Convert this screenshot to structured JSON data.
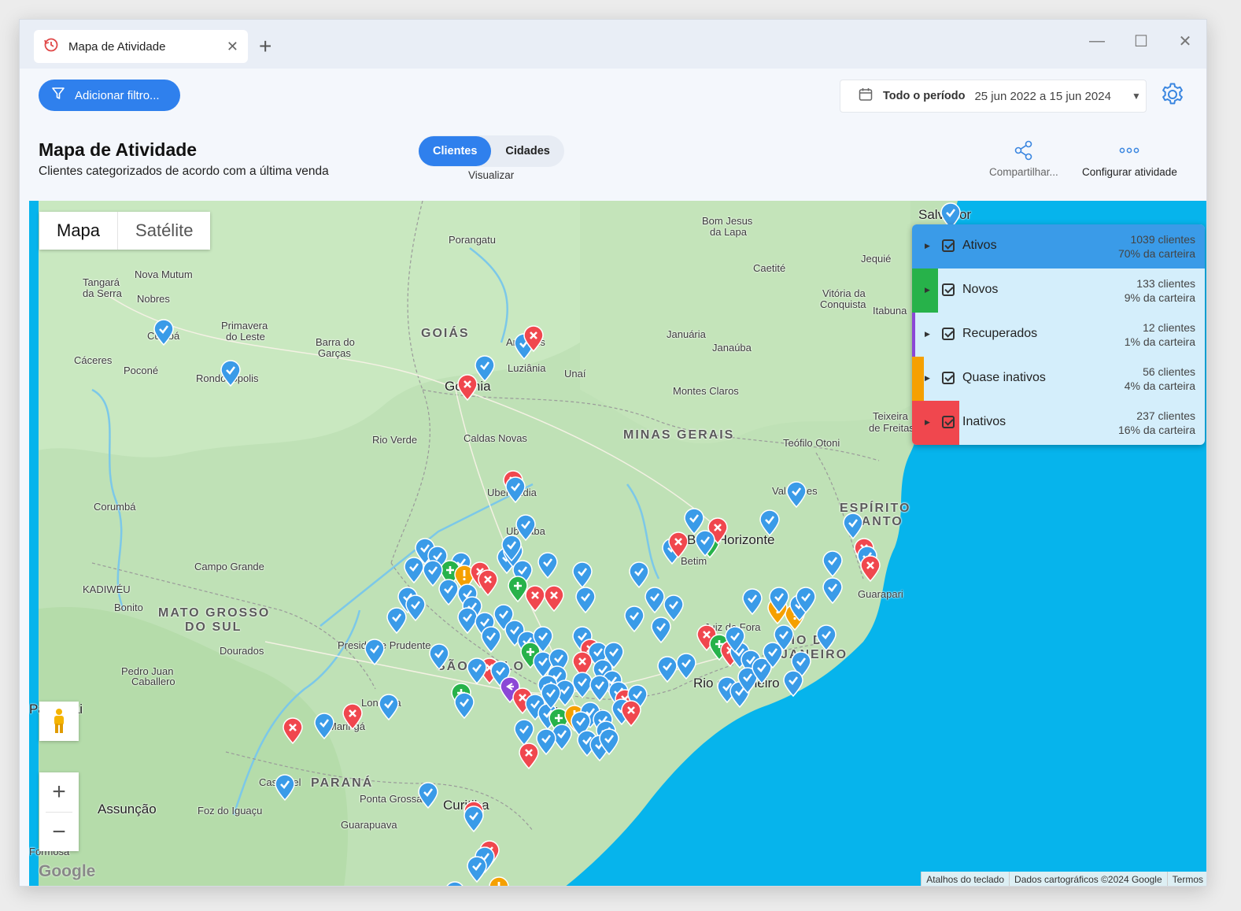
{
  "tab": {
    "title": "Mapa de Atividade",
    "icon": "history-icon",
    "close": "✕",
    "new": "+"
  },
  "window_controls": {
    "minimize": "—",
    "maximize": "☐",
    "close": "✕"
  },
  "toolbar": {
    "filter_label": "Adicionar filtro...",
    "period_label": "Todo o período",
    "period_range": "25 jun 2022 a 15 jun 2024"
  },
  "header": {
    "title": "Mapa de Atividade",
    "subtitle": "Clientes categorizados de acordo com a última venda",
    "view_options": [
      "Clientes",
      "Cidades"
    ],
    "view_selected": "Clientes",
    "view_caption": "Visualizar",
    "share_label": "Compartilhar...",
    "config_label": "Configurar atividade"
  },
  "map": {
    "type_options": [
      "Mapa",
      "Satélite"
    ],
    "type_selected": "Mapa",
    "zoom_in": "+",
    "zoom_out": "−",
    "logo": "Google",
    "attribution": [
      "Atalhos do teclado",
      "Dados cartográficos ©2024 Google",
      "Termos"
    ],
    "labels": [
      {
        "text": "Salvador",
        "cls": "big"
      },
      {
        "text": "Bom Jesus"
      },
      {
        "text": "da Lapa"
      },
      {
        "text": "Porangatu"
      },
      {
        "text": "Caetité"
      },
      {
        "text": "Jequié"
      },
      {
        "text": "Tangará"
      },
      {
        "text": "da Serra"
      },
      {
        "text": "Nova Mutum"
      },
      {
        "text": "Nobres"
      },
      {
        "text": "Primavera"
      },
      {
        "text": "do Leste"
      },
      {
        "text": "Barra do"
      },
      {
        "text": "Garças"
      },
      {
        "text": "GOIÁS",
        "cls": "state"
      },
      {
        "text": "Anápolis"
      },
      {
        "text": "Luziânia"
      },
      {
        "text": "Unaí"
      },
      {
        "text": "Januária"
      },
      {
        "text": "Janaúba"
      },
      {
        "text": "Vitória da"
      },
      {
        "text": "Conquista"
      },
      {
        "text": "Itabuna"
      },
      {
        "text": "Cáceres"
      },
      {
        "text": "Poconé"
      },
      {
        "text": "Cuiabá"
      },
      {
        "text": "Rondonópolis"
      },
      {
        "text": "Goiânia",
        "cls": "big"
      },
      {
        "text": "Montes Claros"
      },
      {
        "text": "Rio Verde"
      },
      {
        "text": "Caldas Novas"
      },
      {
        "text": "MINAS GERAIS",
        "cls": "state"
      },
      {
        "text": "Teófilo Otoni"
      },
      {
        "text": "Teixeira"
      },
      {
        "text": "de Freitas"
      },
      {
        "text": "Corumbá"
      },
      {
        "text": "Uberlândia"
      },
      {
        "text": "Valadares"
      },
      {
        "text": "ESPÍRITO",
        "cls": "state"
      },
      {
        "text": "SANTO",
        "cls": "state"
      },
      {
        "text": "Uberaba"
      },
      {
        "text": "Belo Horizonte",
        "cls": "big"
      },
      {
        "text": "Betim"
      },
      {
        "text": "Campo Grande"
      },
      {
        "text": "KADIWÉU"
      },
      {
        "text": "Bonito"
      },
      {
        "text": "MATO GROSSO",
        "cls": "state"
      },
      {
        "text": "DO SUL",
        "cls": "state"
      },
      {
        "text": "Guarapari"
      },
      {
        "text": "Juiz de Fora"
      },
      {
        "text": "Presidente Prudente"
      },
      {
        "text": "Dourados"
      },
      {
        "text": "SÃO PAULO",
        "cls": "state"
      },
      {
        "text": "RIO DE",
        "cls": "state"
      },
      {
        "text": "JANEIRO",
        "cls": "state"
      },
      {
        "text": "Rio de Janeiro",
        "cls": "big"
      },
      {
        "text": "Pedro Juan"
      },
      {
        "text": "Caballero"
      },
      {
        "text": "Paraguai",
        "cls": "big"
      },
      {
        "text": "Londrina"
      },
      {
        "text": "Maringá"
      },
      {
        "text": "São Paulo",
        "cls": "big"
      },
      {
        "text": "Cascavel"
      },
      {
        "text": "PARANÁ",
        "cls": "state"
      },
      {
        "text": "Ponta Grossa"
      },
      {
        "text": "Curitiba",
        "cls": "big"
      },
      {
        "text": "Assunção",
        "cls": "big"
      },
      {
        "text": "Foz do Iguaçu"
      },
      {
        "text": "Guarapuava"
      },
      {
        "text": "Formosa"
      }
    ]
  },
  "legend": [
    {
      "name": "Ativos",
      "count": "1039 clientes",
      "share": "70% da carteira",
      "color": "#3a9be8",
      "fill": 0.7
    },
    {
      "name": "Novos",
      "count": "133 clientes",
      "share": "9% da carteira",
      "color": "#27b24a",
      "fill": 0.09
    },
    {
      "name": "Recuperados",
      "count": "12 clientes",
      "share": "1% da carteira",
      "color": "#8b47d6",
      "fill": 0.01
    },
    {
      "name": "Quase inativos",
      "count": "56 clientes",
      "share": "4% da carteira",
      "color": "#f5a000",
      "fill": 0.04
    },
    {
      "name": "Inativos",
      "count": "237 clientes",
      "share": "16% da carteira",
      "color": "#f0474e",
      "fill": 0.16
    }
  ]
}
